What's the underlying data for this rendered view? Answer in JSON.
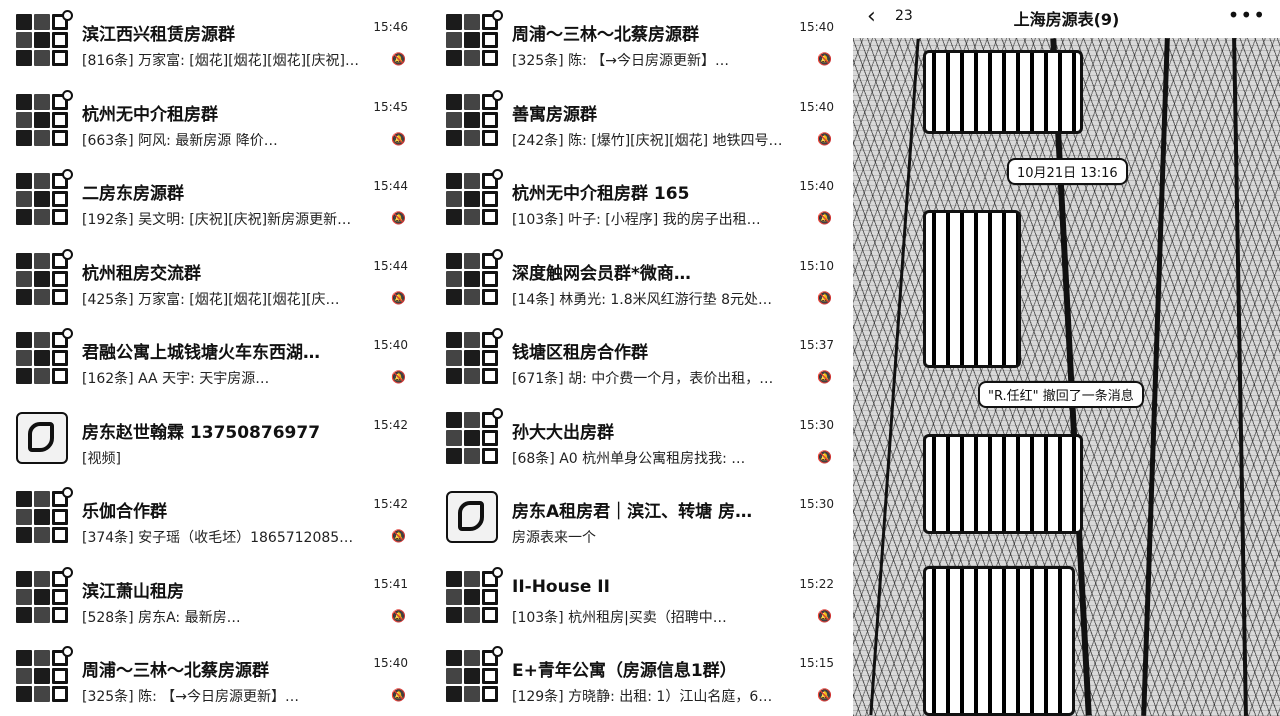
{
  "left_chats": [
    {
      "name": "滨江西兴租赁房源群",
      "time": "15:46",
      "preview": "[816条] 万家富: [烟花][烟花][烟花][庆祝]…",
      "muted": true
    },
    {
      "name": "杭州无中介租房群",
      "time": "15:45",
      "preview": "[663条] 阿风: 最新房源 降价…",
      "muted": true
    },
    {
      "name": "二房东房源群",
      "time": "15:44",
      "preview": "[192条] 吴文明: [庆祝][庆祝]新房源更新…",
      "muted": true
    },
    {
      "name": "杭州租房交流群",
      "time": "15:44",
      "preview": "[425条] 万家富: [烟花][烟花][烟花][庆…",
      "muted": true
    },
    {
      "name": "君融公寓上城钱塘火车东西湖…",
      "time": "15:40",
      "preview": "[162条] AA 天宇: 天宇房源…",
      "muted": true
    },
    {
      "name": "房东赵世翰霖 13750876977",
      "time": "15:42",
      "preview": "[视频]",
      "muted": false,
      "solo": true
    },
    {
      "name": "乐伽合作群",
      "time": "15:42",
      "preview": "[374条] 安子瑶（收毛坯）1865712085…",
      "muted": true
    },
    {
      "name": "滨江萧山租房",
      "time": "15:41",
      "preview": "[528条] 房东A: 最新房…",
      "muted": true
    },
    {
      "name": "周浦～三林～北蔡房源群",
      "time": "15:40",
      "preview": "[325条] 陈: 【→今日房源更新】…",
      "muted": true
    }
  ],
  "mid_chats": [
    {
      "name": "周浦～三林～北蔡房源群",
      "time": "15:40",
      "preview": "[325条] 陈: 【→今日房源更新】…",
      "muted": true
    },
    {
      "name": "善寓房源群",
      "time": "15:40",
      "preview": "[242条] 陈: [爆竹][庆祝][烟花] 地铁四号…",
      "muted": true
    },
    {
      "name": "杭州无中介租房群 165",
      "time": "15:40",
      "preview": "[103条] 叶子: [小程序] 我的房子出租…",
      "muted": true
    },
    {
      "name": "深度触网会员群*微商…",
      "time": "15:10",
      "preview": "[14条] 林勇光: 1.8米风红游行垫 8元处…",
      "muted": true
    },
    {
      "name": "钱塘区租房合作群",
      "time": "15:37",
      "preview": "[671条] 胡: 中介费一个月，表价出租，…",
      "muted": true
    },
    {
      "name": "孙大大出房群",
      "time": "15:30",
      "preview": "[68条] A0 杭州单身公寓租房找我: …",
      "muted": true
    },
    {
      "name": "房东A租房君｜滨江、转塘 房…",
      "time": "15:30",
      "preview": "房源表来一个",
      "muted": false,
      "solo": true
    },
    {
      "name": "II-House II",
      "time": "15:22",
      "preview": "[103条] 杭州租房|买卖（招聘中…",
      "muted": true
    },
    {
      "name": "E+青年公寓（房源信息1群）",
      "time": "15:15",
      "preview": "[129条] 方晓静: 出租: 1）江山名庭，6…",
      "muted": true
    }
  ],
  "right_panel": {
    "back_count": "23",
    "title": "上海房源表(9)",
    "timestamp": "10月21日 13:16",
    "recall_notice": "\"R.任红\" 撤回了一条消息"
  }
}
